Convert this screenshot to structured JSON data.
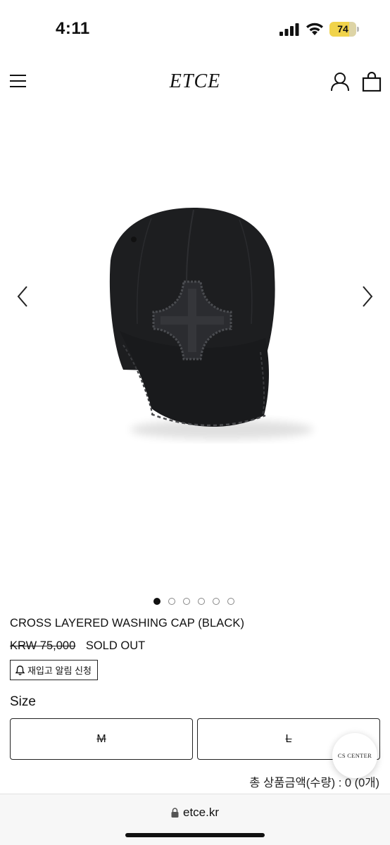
{
  "status_bar": {
    "time": "4:11",
    "battery_level": "74",
    "battery_fill_percent": 74,
    "signal_icon": "cellular-signal-icon",
    "wifi_icon": "wifi-icon"
  },
  "header": {
    "brand": "ETCE",
    "menu_icon": "hamburger-menu-icon",
    "account_icon": "user-account-icon",
    "cart_icon": "shopping-bag-icon"
  },
  "gallery": {
    "total_images": 6,
    "active_index": 0,
    "prev_icon": "chevron-left-icon",
    "next_icon": "chevron-right-icon"
  },
  "product": {
    "title": "CROSS LAYERED WASHING CAP (BLACK)",
    "original_price": "KRW 75,000",
    "status": "SOLD OUT",
    "restock_label": "재입고 알림 신청"
  },
  "options": {
    "size_label": "Size",
    "sizes": [
      "M",
      "L"
    ]
  },
  "cs_center": {
    "label": "CS CENTER"
  },
  "total": {
    "text": "총 상품금액(수량) : 0 (0개)"
  },
  "browser": {
    "url": "etce.kr"
  },
  "colors": {
    "text": "#111111",
    "cap": "#1b1c1e",
    "battery": "#f0d34b",
    "browser_bg": "#f7f7f7"
  }
}
